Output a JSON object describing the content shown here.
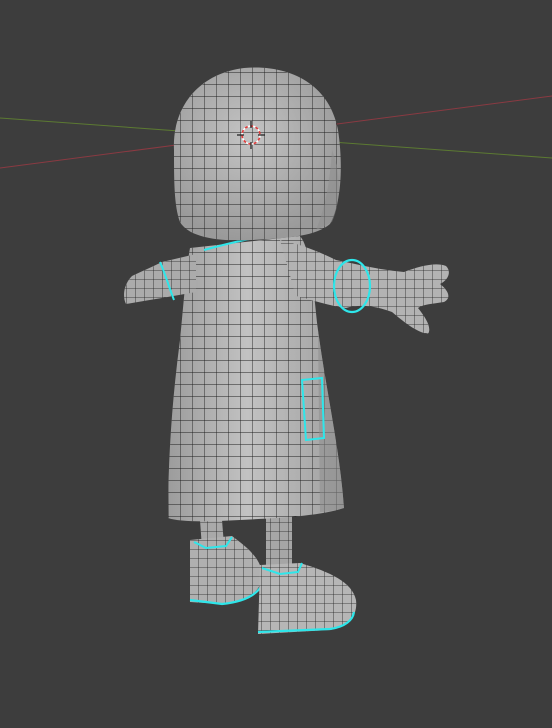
{
  "viewport": {
    "background": "#3d3d3d",
    "mesh_fill": "#b4b4b4",
    "mesh_shadow": "#8e8e8e",
    "wire_color": "#1e1e1e",
    "seam_color": "#2ee6ea",
    "x_axis_color": "#8a3a42",
    "y_axis_color": "#5c7a32",
    "cursor_color": "#e23b3b"
  },
  "icons": {
    "cursor": "3d-cursor-icon"
  }
}
